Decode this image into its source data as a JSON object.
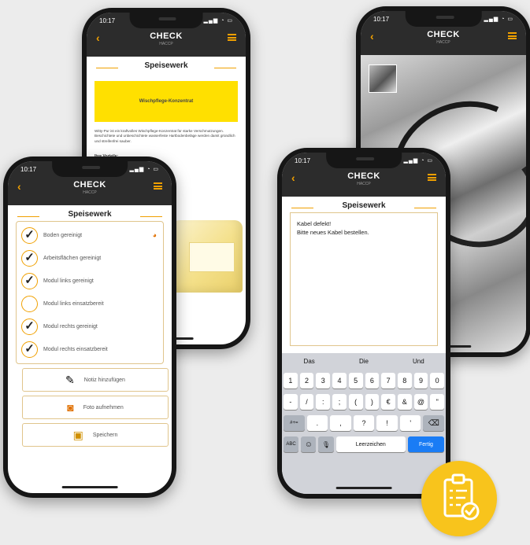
{
  "status": {
    "time": "10:17"
  },
  "brand": {
    "name": "CHECK",
    "sub": "HACCP"
  },
  "screen_title": "Speisewerk",
  "phone1": {
    "banner_label": "Wischpflege-Konzentrat",
    "description": "Witty-Pur ist ein kraftvolles Wischpflege-Konzentrat für starke Verschmutzungen. Beschichtete und unbeschichtete wasserfeste Hartbodenbeläge werden damit gründlich und streifenfrei sauber.",
    "subheading": "Ihre Vorteile:"
  },
  "phone2": {
    "checklist": [
      {
        "label": "Boden gereinigt",
        "checked": true
      },
      {
        "label": "Arbeitsflächen gereinigt",
        "checked": true
      },
      {
        "label": "Modul links gereinigt",
        "checked": true
      },
      {
        "label": "Modul links einsatzbereit",
        "checked": false
      },
      {
        "label": "Modul rechts gereinigt",
        "checked": true
      },
      {
        "label": "Modul rechts einsatzbereit",
        "checked": true
      }
    ],
    "actions": {
      "note": "Notiz hinzufügen",
      "photo": "Foto aufnehmen",
      "save": "Speichern"
    }
  },
  "phone4": {
    "note_line1": "Kabel defekt!",
    "note_line2": "Bitte neues Kabel bestellen.",
    "suggestions": [
      "Das",
      "Die",
      "Und"
    ],
    "row1": [
      "1",
      "2",
      "3",
      "4",
      "5",
      "6",
      "7",
      "8",
      "9",
      "0"
    ],
    "row2": [
      "-",
      "/",
      ":",
      ";",
      "(",
      ")",
      "€",
      "&",
      "@",
      "\""
    ],
    "row3": {
      "mode": "#+=",
      "keys": [
        ".",
        ",",
        "?",
        "!",
        "'"
      ],
      "delete": "⌫"
    },
    "row4": {
      "abc": "ABC",
      "emoji": "☺",
      "mic": "🎙",
      "space": "Leerzeichen",
      "done": "Fertig"
    }
  },
  "colors": {
    "accent": "#f0a000",
    "badge": "#f8c41c",
    "banner": "#ffe000",
    "done_key": "#1a7cf5"
  },
  "icons": [
    "chevron-left-icon",
    "hamburger-icon",
    "checkmark-icon",
    "camera-icon",
    "pencil-note-icon",
    "floppy-save-icon",
    "clipboard-check-icon"
  ]
}
